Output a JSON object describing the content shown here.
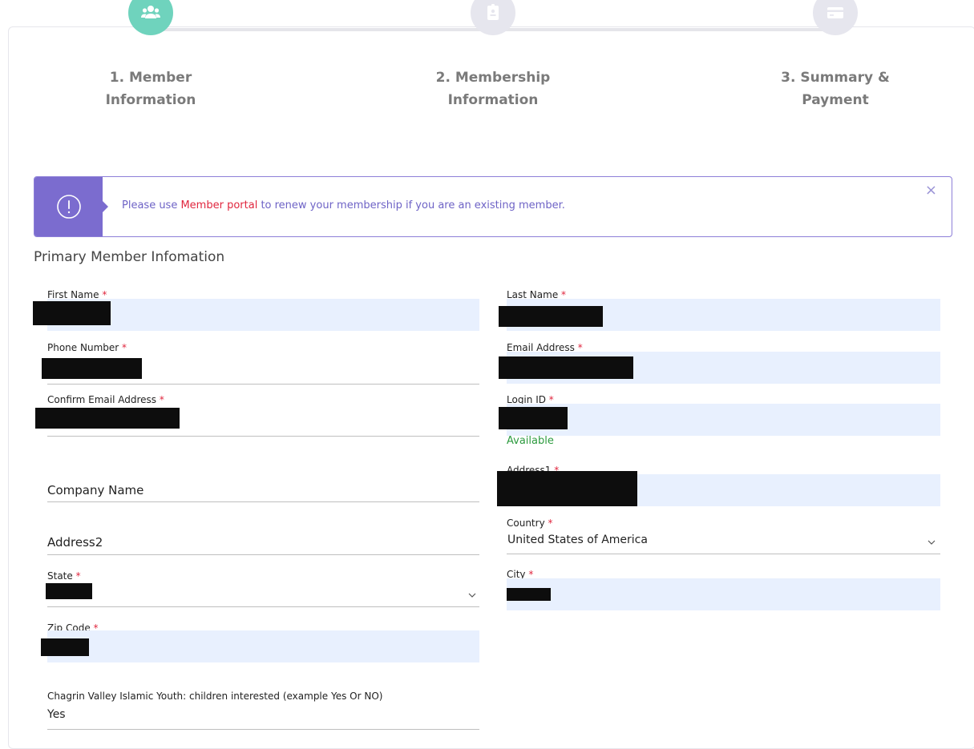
{
  "steps": [
    {
      "number_label": "1. Member",
      "label2": "Information",
      "icon": "users-icon",
      "color": "#6fd3bd"
    },
    {
      "number_label": "2. Membership",
      "label2": "Information",
      "icon": "badge-icon",
      "color": "#e6e6ee"
    },
    {
      "number_label": "3. Summary &",
      "label2": "Payment",
      "icon": "credit-card-icon",
      "color": "#e6e6ee"
    }
  ],
  "alert": {
    "prefix": "Please use ",
    "link": "Member portal",
    "suffix": " to renew your membership if you are an existing member.",
    "close": "×",
    "accent": "#7b6ccf"
  },
  "section_title": "Primary Member Infomation",
  "fields": {
    "first_name": {
      "label": "First Name",
      "req": "*"
    },
    "last_name": {
      "label": "Last Name",
      "req": "*"
    },
    "phone": {
      "label": "Phone Number",
      "req": "*"
    },
    "email": {
      "label": "Email Address",
      "req": "*"
    },
    "confirm_email": {
      "label": "Confirm Email Address",
      "req": "*"
    },
    "login_id": {
      "label": "Login ID",
      "req": "*",
      "status": "Available"
    },
    "address1": {
      "label": "Address1",
      "req": "*"
    },
    "company": {
      "label": "Company Name"
    },
    "address2": {
      "label": "Address2"
    },
    "country": {
      "label": "Country",
      "req": "*",
      "value": "United States of America"
    },
    "state": {
      "label": "State",
      "req": "*"
    },
    "city": {
      "label": "City",
      "req": "*"
    },
    "zip": {
      "label": "Zip Code",
      "req": "*"
    },
    "youth": {
      "label": "Chagrin Valley Islamic Youth: children interested (example Yes Or NO)",
      "value": "Yes"
    }
  }
}
